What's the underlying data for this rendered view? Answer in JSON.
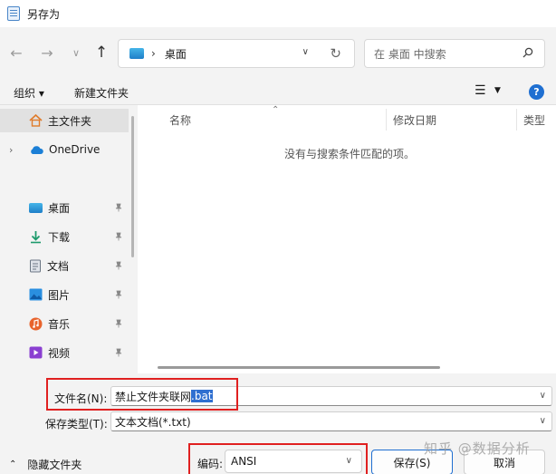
{
  "window": {
    "title": "另存为"
  },
  "nav": {
    "back_icon": "arrow-left-icon",
    "forward_icon": "arrow-right-icon",
    "recent_icon": "chevron-down-icon",
    "up_icon": "arrow-up-icon",
    "address_crumb": "桌面",
    "search_placeholder": "在 桌面 中搜索"
  },
  "toolbar": {
    "organize": "组织 ▾",
    "new_folder": "新建文件夹",
    "help": "?"
  },
  "sidebar": {
    "items": [
      {
        "label": "主文件夹",
        "icon": "home-icon",
        "selected": true
      },
      {
        "label": "OneDrive",
        "icon": "cloud-icon"
      },
      {
        "label": "桌面",
        "icon": "desktop-icon",
        "pinned": true
      },
      {
        "label": "下载",
        "icon": "download-icon",
        "pinned": true
      },
      {
        "label": "文档",
        "icon": "document-icon",
        "pinned": true
      },
      {
        "label": "图片",
        "icon": "picture-icon",
        "pinned": true
      },
      {
        "label": "音乐",
        "icon": "music-icon",
        "pinned": true
      },
      {
        "label": "视频",
        "icon": "video-icon",
        "pinned": true
      }
    ]
  },
  "file_list": {
    "columns": [
      "名称",
      "修改日期",
      "类型"
    ],
    "empty_message": "没有与搜索条件匹配的项。"
  },
  "form": {
    "filename_label": "文件名(N):",
    "filename_value_unselected": "禁止文件夹联网",
    "filename_value_selected": ".bat",
    "filetype_label": "保存类型(T):",
    "filetype_value": "文本文档(*.txt)",
    "hide_folders": "隐藏文件夹",
    "encoding_label": "编码:",
    "encoding_value": "ANSI",
    "save_button": "保存(S)",
    "cancel_button": "取消"
  },
  "watermark": "知乎 @数据分析",
  "colors": {
    "accent": "#1f6fd1",
    "highlight_box": "#e02020",
    "selection": "#2f6fd0"
  }
}
